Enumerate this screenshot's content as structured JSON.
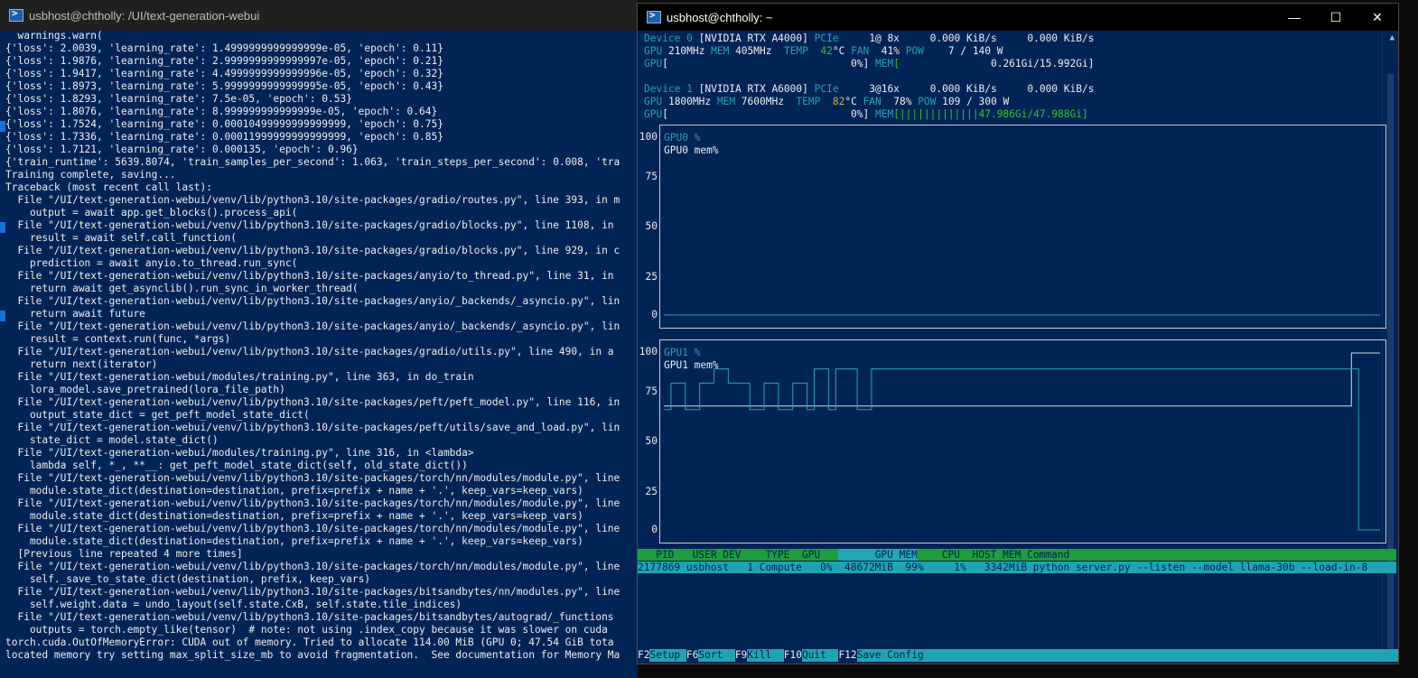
{
  "left_window": {
    "title": "usbhost@chtholly: /UI/text-generation-webui",
    "lines": [
      "  warnings.warn(",
      "{'loss': 2.0039, 'learning_rate': 1.4999999999999999e-05, 'epoch': 0.11}",
      "{'loss': 1.9876, 'learning_rate': 2.9999999999999997e-05, 'epoch': 0.21}",
      "{'loss': 1.9417, 'learning_rate': 4.4999999999999996e-05, 'epoch': 0.32}",
      "{'loss': 1.8973, 'learning_rate': 5.9999999999999995e-05, 'epoch': 0.43}",
      "{'loss': 1.8293, 'learning_rate': 7.5e-05, 'epoch': 0.53}",
      "{'loss': 1.8076, 'learning_rate': 8.999999999999999e-05, 'epoch': 0.64}",
      "{'loss': 1.7524, 'learning_rate': 0.00010499999999999999, 'epoch': 0.75}",
      "{'loss': 1.7336, 'learning_rate': 0.00011999999999999999, 'epoch': 0.85}",
      "{'loss': 1.7121, 'learning_rate': 0.000135, 'epoch': 0.96}",
      "{'train_runtime': 5639.8074, 'train_samples_per_second': 1.063, 'train_steps_per_second': 0.008, 'tra",
      "Training complete, saving...",
      "Traceback (most recent call last):",
      "  File \"/UI/text-generation-webui/venv/lib/python3.10/site-packages/gradio/routes.py\", line 393, in m",
      "    output = await app.get_blocks().process_api(",
      "  File \"/UI/text-generation-webui/venv/lib/python3.10/site-packages/gradio/blocks.py\", line 1108, in",
      "    result = await self.call_function(",
      "  File \"/UI/text-generation-webui/venv/lib/python3.10/site-packages/gradio/blocks.py\", line 929, in c",
      "    prediction = await anyio.to_thread.run_sync(",
      "  File \"/UI/text-generation-webui/venv/lib/python3.10/site-packages/anyio/to_thread.py\", line 31, in",
      "    return await get_asynclib().run_sync_in_worker_thread(",
      "  File \"/UI/text-generation-webui/venv/lib/python3.10/site-packages/anyio/_backends/_asyncio.py\", lin",
      "    return await future",
      "  File \"/UI/text-generation-webui/venv/lib/python3.10/site-packages/anyio/_backends/_asyncio.py\", lin",
      "    result = context.run(func, *args)",
      "  File \"/UI/text-generation-webui/venv/lib/python3.10/site-packages/gradio/utils.py\", line 490, in a",
      "    return next(iterator)",
      "  File \"/UI/text-generation-webui/modules/training.py\", line 363, in do_train",
      "    lora_model.save_pretrained(lora_file_path)",
      "  File \"/UI/text-generation-webui/venv/lib/python3.10/site-packages/peft/peft_model.py\", line 116, in",
      "    output_state_dict = get_peft_model_state_dict(",
      "  File \"/UI/text-generation-webui/venv/lib/python3.10/site-packages/peft/utils/save_and_load.py\", lin",
      "    state_dict = model.state_dict()",
      "  File \"/UI/text-generation-webui/modules/training.py\", line 316, in <lambda>",
      "    lambda self, *_, **__: get_peft_model_state_dict(self, old_state_dict())",
      "  File \"/UI/text-generation-webui/venv/lib/python3.10/site-packages/torch/nn/modules/module.py\", line",
      "    module.state_dict(destination=destination, prefix=prefix + name + '.', keep_vars=keep_vars)",
      "  File \"/UI/text-generation-webui/venv/lib/python3.10/site-packages/torch/nn/modules/module.py\", line",
      "    module.state_dict(destination=destination, prefix=prefix + name + '.', keep_vars=keep_vars)",
      "  File \"/UI/text-generation-webui/venv/lib/python3.10/site-packages/torch/nn/modules/module.py\", line",
      "    module.state_dict(destination=destination, prefix=prefix + name + '.', keep_vars=keep_vars)",
      "  [Previous line repeated 4 more times]",
      "  File \"/UI/text-generation-webui/venv/lib/python3.10/site-packages/torch/nn/modules/module.py\", line",
      "    self._save_to_state_dict(destination, prefix, keep_vars)",
      "  File \"/UI/text-generation-webui/venv/lib/python3.10/site-packages/bitsandbytes/nn/modules.py\", line",
      "    self.weight.data = undo_layout(self.state.CxB, self.state.tile_indices)",
      "  File \"/UI/text-generation-webui/venv/lib/python3.10/site-packages/bitsandbytes/autograd/_functions",
      "    outputs = torch.empty_like(tensor)  # note: not using .index_copy because it was slower on cuda",
      "torch.cuda.OutOfMemoryError: CUDA out of memory. Tried to allocate 114.00 MiB (GPU 0; 47.54 GiB tota",
      "located memory try setting max_split_size_mb to avoid fragmentation.  See documentation for Memory Ma"
    ]
  },
  "right_window": {
    "title": "usbhost@chtholly: ~",
    "buttons": {
      "minimize": "—",
      "maximize": "☐",
      "close": "✕"
    },
    "devices": [
      {
        "l1": [
          "Device 0 ",
          "[NVIDIA RTX A4000] ",
          "PCIe ",
          "    1@ 8x     0.000 KiB/s     0.000 KiB/s"
        ],
        "l2": [
          "GPU ",
          "210MHz ",
          "MEM ",
          "405MHz  ",
          "TEMP  ",
          "42",
          "°C ",
          "FAN  ",
          "41% ",
          "POW  ",
          "  7 / 140 W"
        ],
        "l3": [
          "GPU",
          "[                              0%] ",
          "MEM",
          "[               ",
          "0.261Gi/15.992Gi]"
        ],
        "mem_fraction": 0.016
      },
      {
        "l1": [
          "Device 1 ",
          "[NVIDIA RTX A6000] ",
          "PCIe ",
          "    3@16x     0.000 KiB/s     0.000 KiB/s"
        ],
        "l2": [
          "GPU ",
          "1800MHz ",
          "MEM ",
          "7600MHz  ",
          "TEMP  ",
          "82",
          "°C ",
          "FAN  ",
          "78% ",
          "POW ",
          "109 / 300 W"
        ],
        "l3": [
          "GPU",
          "[                              0%] ",
          "MEM",
          "[|||||||||||||",
          "47.986Gi/47.988Gi]"
        ],
        "mem_fraction": 1.0
      }
    ],
    "graphs": [
      {
        "series_labels": [
          "GPU0 %",
          "GPU0 mem%"
        ],
        "yticks": [
          "100",
          "75",
          "50",
          "25",
          "0"
        ],
        "gpu_util": [
          0,
          0,
          0,
          0,
          0,
          0,
          0,
          0,
          0,
          0,
          0,
          0,
          0,
          0,
          0,
          0,
          0,
          0,
          0,
          0,
          0,
          0,
          0,
          0,
          0,
          0,
          0,
          0,
          0,
          0,
          0,
          0,
          0,
          0,
          0,
          0,
          0,
          0,
          0,
          0,
          0,
          0,
          0,
          0,
          0,
          0,
          0,
          0,
          0,
          0,
          0,
          0,
          0,
          0,
          0,
          0,
          0,
          0,
          0,
          0,
          0,
          0,
          0,
          0,
          0,
          0,
          0,
          0,
          0,
          0,
          0,
          0,
          0,
          0,
          0,
          0,
          0,
          0,
          0,
          0,
          0,
          0,
          0,
          0,
          0,
          0,
          0,
          0,
          0,
          0,
          0,
          0,
          0,
          0,
          0,
          0,
          0,
          0,
          0,
          0
        ],
        "mem_util": [
          0,
          0,
          0,
          0,
          0,
          0,
          0,
          0,
          0,
          0,
          0,
          0,
          0,
          0,
          0,
          0,
          0,
          0,
          0,
          0,
          0,
          0,
          0,
          0,
          0,
          0,
          0,
          0,
          0,
          0,
          0,
          0,
          0,
          0,
          0,
          0,
          0,
          0,
          0,
          0,
          0,
          0,
          0,
          0,
          0,
          0,
          0,
          0,
          0,
          0,
          0,
          0,
          0,
          0,
          0,
          0,
          0,
          0,
          0,
          0,
          0,
          0,
          0,
          0,
          0,
          0,
          0,
          0,
          0,
          0,
          0,
          0,
          0,
          0,
          0,
          0,
          0,
          0,
          0,
          0,
          0,
          0,
          0,
          0,
          0,
          0,
          0,
          0,
          0,
          0,
          0,
          0,
          0,
          0,
          0,
          0,
          0,
          0,
          0,
          0
        ]
      },
      {
        "series_labels": [
          "GPU1 %",
          "GPU1 mem%"
        ],
        "yticks": [
          "100",
          "75",
          "50",
          "25",
          "0"
        ],
        "gpu_util": [
          68,
          83,
          83,
          68,
          68,
          83,
          83,
          91,
          91,
          83,
          83,
          83,
          68,
          68,
          83,
          83,
          68,
          68,
          83,
          83,
          68,
          91,
          91,
          68,
          91,
          91,
          91,
          68,
          68,
          91,
          91,
          91,
          91,
          91,
          91,
          91,
          91,
          91,
          91,
          91,
          91,
          91,
          91,
          91,
          91,
          91,
          91,
          91,
          91,
          91,
          91,
          91,
          91,
          91,
          91,
          91,
          91,
          91,
          91,
          91,
          91,
          91,
          91,
          91,
          91,
          91,
          91,
          91,
          91,
          91,
          91,
          91,
          91,
          91,
          91,
          91,
          91,
          91,
          91,
          91,
          91,
          91,
          91,
          91,
          91,
          91,
          91,
          91,
          91,
          91,
          91,
          91,
          91,
          91,
          91,
          91,
          91,
          0,
          0,
          0
        ],
        "mem_util": [
          70,
          70,
          70,
          70,
          70,
          70,
          70,
          70,
          70,
          70,
          70,
          70,
          70,
          70,
          70,
          70,
          70,
          70,
          70,
          70,
          70,
          70,
          70,
          70,
          70,
          70,
          70,
          70,
          70,
          70,
          70,
          70,
          70,
          70,
          70,
          70,
          70,
          70,
          70,
          70,
          70,
          70,
          70,
          70,
          70,
          70,
          70,
          70,
          70,
          70,
          70,
          70,
          70,
          70,
          70,
          70,
          70,
          70,
          70,
          70,
          70,
          70,
          70,
          70,
          70,
          70,
          70,
          70,
          70,
          70,
          70,
          70,
          70,
          70,
          70,
          70,
          70,
          70,
          70,
          70,
          70,
          70,
          70,
          70,
          70,
          70,
          70,
          70,
          70,
          70,
          70,
          70,
          70,
          70,
          70,
          70,
          100,
          100,
          100,
          100
        ]
      }
    ],
    "process_header": {
      "pre": "   PID   USER DEV    TYPE  GPU   ",
      "hl": "      GPU MEM",
      "mid": "    CPU  ",
      "post": "HOST MEM Command"
    },
    "process_row": "2177869 usbhost   1 Compute   0%  48672MiB  99%     1%   3342MiB python server.py --listen --model llama-30b --load-in-8",
    "fkeys": [
      {
        "key": "F2",
        "label": "Setup "
      },
      {
        "key": "F6",
        "label": "Sort  "
      },
      {
        "key": "F9",
        "label": "Kill  "
      },
      {
        "key": "F10",
        "label": "Quit  "
      },
      {
        "key": "F12",
        "label": "Save Config                                                                                 "
      }
    ]
  },
  "colors": {
    "terminal_bg": "#012456",
    "label_cyan": "#2aa1b3",
    "bar_green": "#33c433",
    "temp_yellow": "#c8b43a",
    "header_green": "#1f9c3d",
    "row_cyan": "#21a4b2"
  }
}
